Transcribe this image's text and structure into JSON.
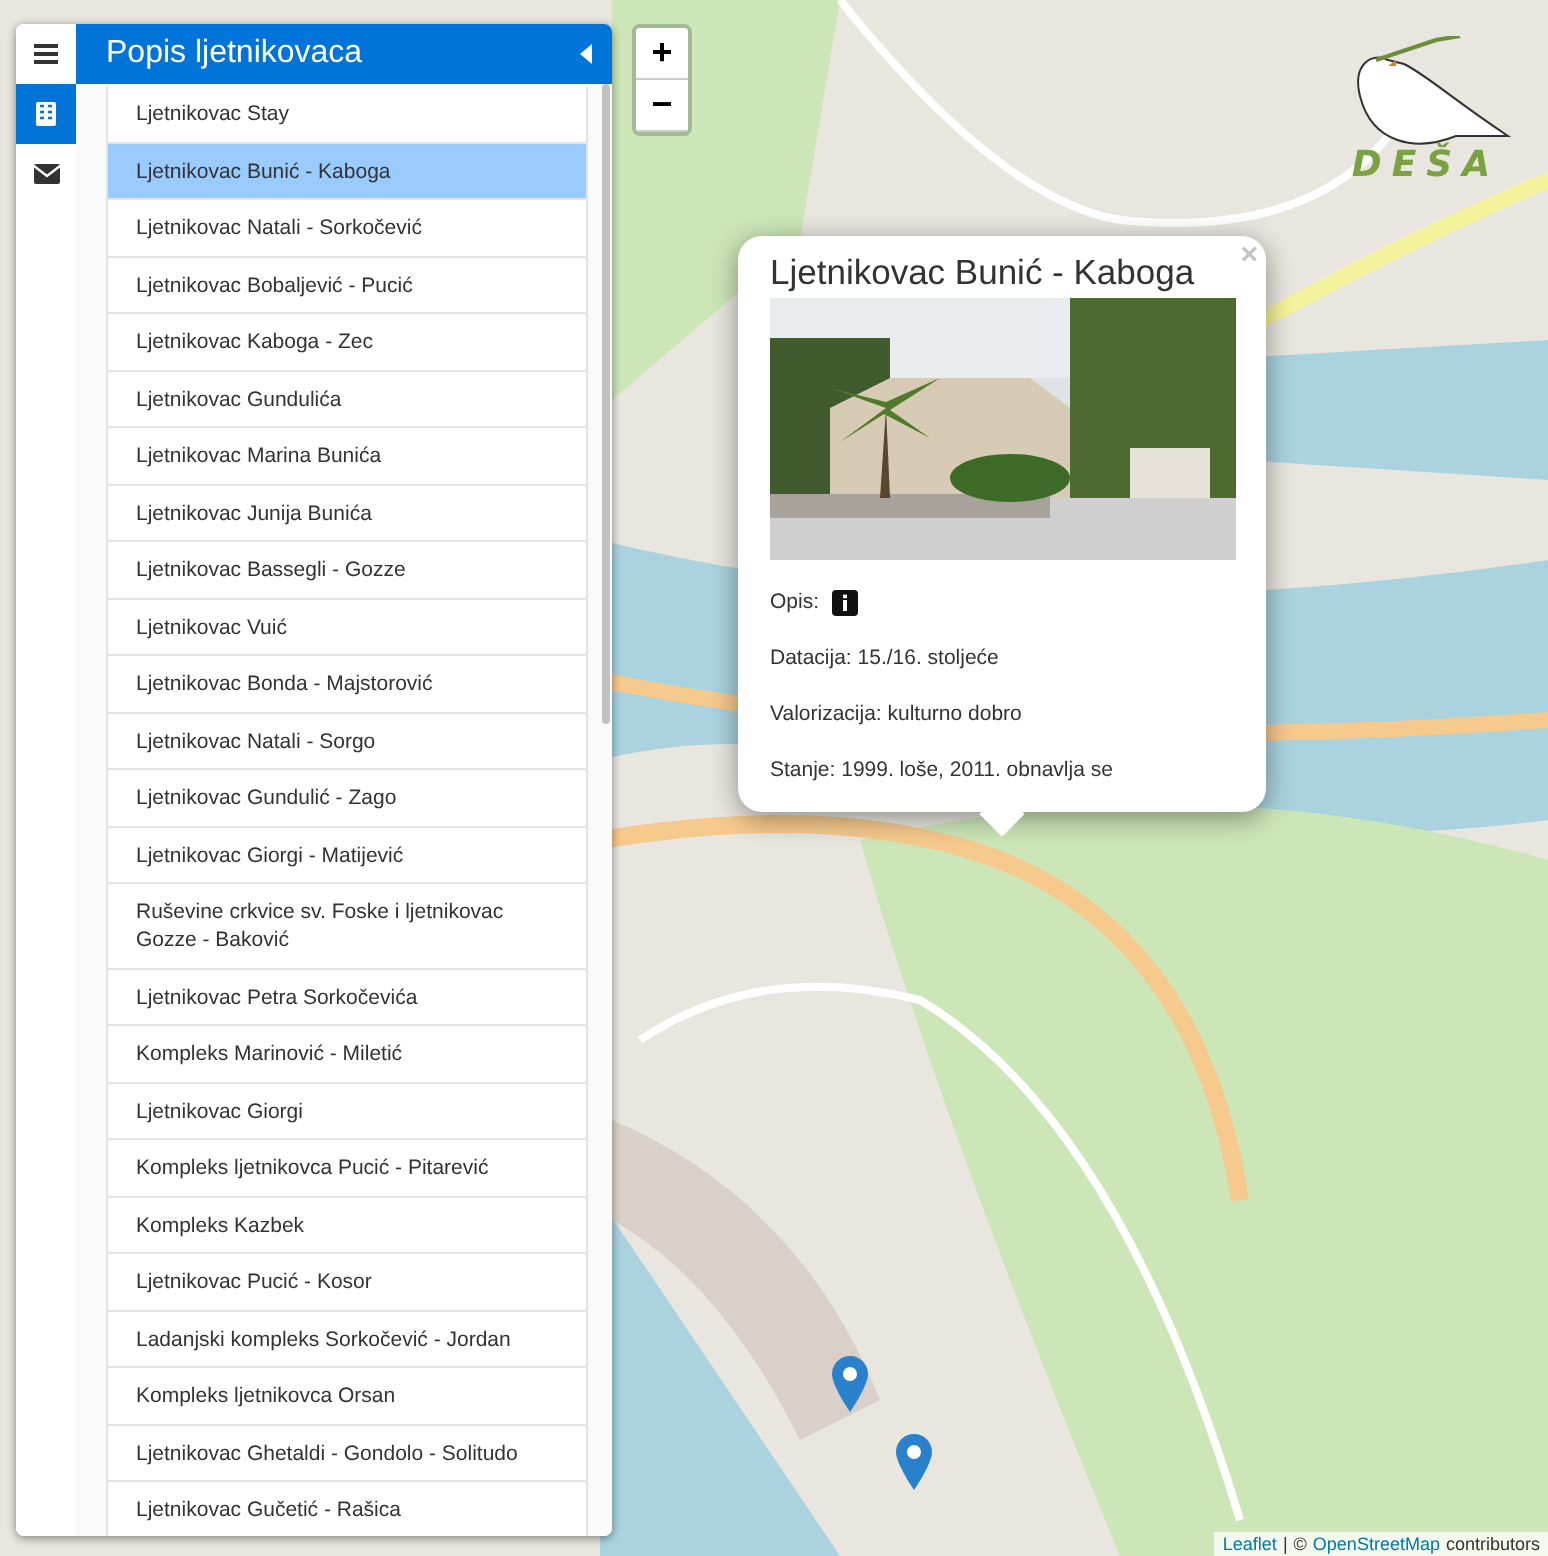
{
  "sidebar": {
    "tabs": [
      {
        "kind": "menu",
        "selected": false
      },
      {
        "kind": "building",
        "selected": true
      },
      {
        "kind": "mail",
        "selected": false
      }
    ],
    "title": "Popis ljetnikovaca",
    "items": [
      {
        "label": "Ljetnikovac Stay",
        "selected": false
      },
      {
        "label": "Ljetnikovac Bunić - Kaboga",
        "selected": true
      },
      {
        "label": "Ljetnikovac Natali - Sorkočević",
        "selected": false
      },
      {
        "label": "Ljetnikovac Bobaljević - Pucić",
        "selected": false
      },
      {
        "label": "Ljetnikovac Kaboga - Zec",
        "selected": false
      },
      {
        "label": "Ljetnikovac Gundulića",
        "selected": false
      },
      {
        "label": "Ljetnikovac Marina Bunića",
        "selected": false
      },
      {
        "label": "Ljetnikovac Junija Bunića",
        "selected": false
      },
      {
        "label": "Ljetnikovac Bassegli - Gozze",
        "selected": false
      },
      {
        "label": "Ljetnikovac Vuić",
        "selected": false
      },
      {
        "label": "Ljetnikovac Bonda - Majstorović",
        "selected": false
      },
      {
        "label": "Ljetnikovac Natali - Sorgo",
        "selected": false
      },
      {
        "label": "Ljetnikovac Gundulić - Zago",
        "selected": false
      },
      {
        "label": "Ljetnikovac Giorgi - Matijević",
        "selected": false
      },
      {
        "label": "Ruševine crkvice sv. Foske i ljetnikovac Gozze - Baković",
        "selected": false
      },
      {
        "label": "Ljetnikovac Petra Sorkočevića",
        "selected": false
      },
      {
        "label": "Kompleks Marinović - Miletić",
        "selected": false
      },
      {
        "label": "Ljetnikovac Giorgi",
        "selected": false
      },
      {
        "label": "Kompleks ljetnikovca Pucić - Pitarević",
        "selected": false
      },
      {
        "label": "Kompleks Kazbek",
        "selected": false
      },
      {
        "label": "Ljetnikovac Pucić - Kosor",
        "selected": false
      },
      {
        "label": "Ladanjski kompleks Sorkočević - Jordan",
        "selected": false
      },
      {
        "label": "Kompleks ljetnikovca Orsan",
        "selected": false
      },
      {
        "label": "Ljetnikovac Ghetaldi - Gondolo - Solitudo",
        "selected": false
      },
      {
        "label": "Ljetnikovac Gučetić - Rašica",
        "selected": false
      }
    ]
  },
  "zoom": [
    "+",
    "−"
  ],
  "logo": {
    "text": "DEŠA"
  },
  "popup": {
    "title": "Ljetnikovac Bunić - Kaboga",
    "close": "×",
    "fields": [
      {
        "kind": "info",
        "text": "Opis:"
      },
      {
        "kind": "text",
        "text": "Datacija: 15./16. stoljeće"
      },
      {
        "kind": "text",
        "text": "Valorizacija: kulturno dobro"
      },
      {
        "kind": "text",
        "text": "Stanje: 1999. loše, 2011. obnavlja se"
      }
    ]
  },
  "attribution": {
    "leaflet": "Leaflet",
    "separator": "|",
    "copyright": "©",
    "osm": "OpenStreetMap",
    "suffix": "contributors"
  }
}
